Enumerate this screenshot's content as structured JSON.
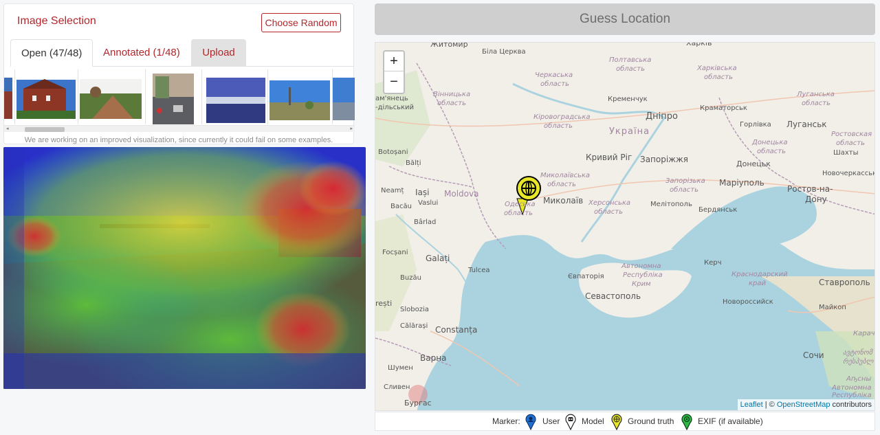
{
  "left": {
    "title": "Image Selection",
    "random_button": "Choose Random",
    "tabs": [
      {
        "label": "Open (47/48)"
      },
      {
        "label": "Annotated (1/48)"
      },
      {
        "label": "Upload"
      }
    ],
    "scroll_left": "◂",
    "scroll_right": "▸",
    "notice": "We are working on an improved visualization, since currently it could fail on some examples."
  },
  "right": {
    "guess_button": "Guess Location",
    "zoom_in": "+",
    "zoom_out": "−",
    "attribution": {
      "leaflet": "Leaflet",
      "sep": " | © ",
      "osm": "OpenStreetMap",
      "tail": " contributors"
    },
    "legend": {
      "prefix": "Marker:",
      "items": [
        {
          "label": "User",
          "color": "#1f6fd1"
        },
        {
          "label": "Model",
          "color": "#ffffff"
        },
        {
          "label": "Ground truth",
          "color": "#e8e628"
        },
        {
          "label": "EXIF (if available)",
          "color": "#2fb84a"
        }
      ]
    }
  },
  "map_labels": {
    "zhytomyr": "Житомир",
    "bila": "Біла Церква",
    "kharkiv": "Харків",
    "poltavska": "Полтавська",
    "oblast": "область",
    "kharkivska": "Харківська",
    "cherkaska": "Черкаська",
    "vinnytska": "Вінницька",
    "kremenchuk": "Кременчук",
    "luhanska": "Луганська",
    "kamianets": "ам'янець",
    "podilskyi": "-дільський",
    "dnipro": "Дніпро",
    "kramatorsk": "Краматорськ",
    "kirovohradska": "Кіровоградська",
    "ukraina": "Україна",
    "horlivka": "Горлівка",
    "luhansk": "Луганськ",
    "rostovska": "Ростовская",
    "oblast_ru": "область",
    "botosani": "Botoșani",
    "donetska": "Донецька",
    "shakhty": "Шахты",
    "balti": "Bălți",
    "kryvyi": "Кривий Ріг",
    "zaporizhzhia": "Запоріжжя",
    "donetsk": "Донецьк",
    "novocherkassk": "Новочеркасськ",
    "mykolaivska": "Миколаївська",
    "neamt": "Neamț",
    "iasi": "Iași",
    "moldova": "Moldova",
    "mykolaiv": "Миколаїв",
    "zaporizka": "Запорізька",
    "mariupol": "Маріуполь",
    "rostov1": "Ростов-на-",
    "rostov2": "Дону",
    "bacau": "Bacău",
    "vaslui": "Vaslui",
    "odeska": "Одеська",
    "khersonska": "Херсонська",
    "melitopol": "Мелітополь",
    "berdiansk": "Бердянськ",
    "barlad": "Bârlad",
    "focsani": "Focșani",
    "galati": "Galați",
    "avtonomna": "Автономна",
    "kerch": "Керч",
    "tulcea": "Tulcea",
    "respublika": "Республіка",
    "krasnodarskiy": "Краснодарский",
    "buzau": "Buzău",
    "yevpatoria": "Євпаторія",
    "krym": "Крим",
    "krai": "край",
    "stavropol": "Ставрополь",
    "sevastopol": "Севастополь",
    "novorossiysk": "Новороссийск",
    "bresti": "rești",
    "slobozia": "Slobozia",
    "maikop": "Майкоп",
    "calarasi": "Călărași",
    "constanta": "Constanța",
    "varna": "Варна",
    "sochi": "Сочи",
    "shumen": "Шумен",
    "sliven": "Сливен",
    "burgas": "Бургас",
    "karach": "Карач",
    "abkhaz1": "ავტონომ",
    "abkhaz2": "რესპუბლ",
    "abkhaz3": "Аҧсны",
    "abkhaz4": "Автономна",
    "abkhaz5": "Республіка"
  }
}
